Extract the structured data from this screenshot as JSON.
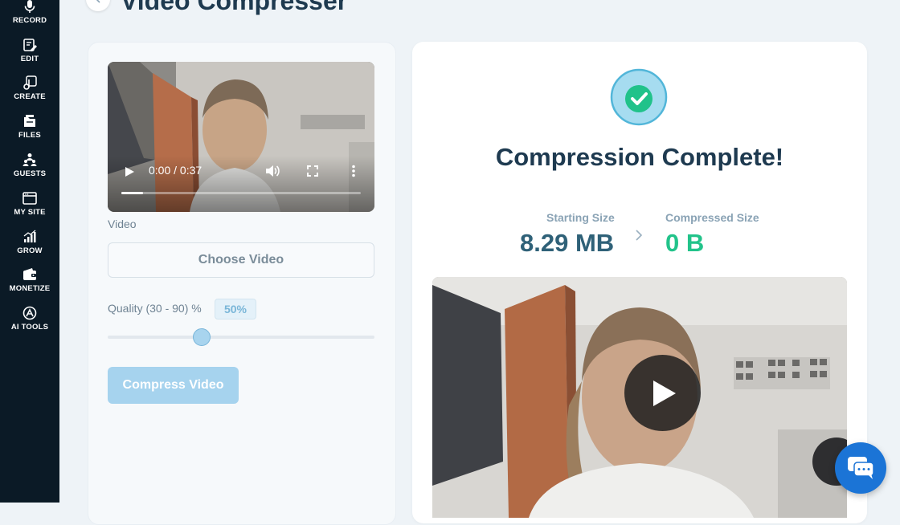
{
  "sidebar": {
    "items": [
      {
        "label": "RECORD",
        "icon": "microphone-icon"
      },
      {
        "label": "EDIT",
        "icon": "edit-icon"
      },
      {
        "label": "CREATE",
        "icon": "music-note-icon"
      },
      {
        "label": "FILES",
        "icon": "files-icon"
      },
      {
        "label": "GUESTS",
        "icon": "guests-icon"
      },
      {
        "label": "MY SITE",
        "icon": "browser-icon"
      },
      {
        "label": "GROW",
        "icon": "bar-chart-icon"
      },
      {
        "label": "MONETIZE",
        "icon": "wallet-icon"
      },
      {
        "label": "AI TOOLS",
        "icon": "ai-icon"
      }
    ]
  },
  "header": {
    "title": "Video Compresser",
    "back_icon": "chevron-left-icon"
  },
  "input_panel": {
    "player": {
      "time": "0:00 / 0:37",
      "progress": 0.09
    },
    "video_label": "Video",
    "choose_button": "Choose Video",
    "quality_label": "Quality (30 - 90) %",
    "quality_value": "50%",
    "quality_slider": 0.35,
    "compress_button": "Compress Video"
  },
  "result_panel": {
    "status_icon": "check-circle-icon",
    "title": "Compression Complete!",
    "starting_label": "Starting Size",
    "starting_value": "8.29 MB",
    "compressed_label": "Compressed Size",
    "compressed_value": "0 B",
    "arrow_icon": "chevron-right-icon",
    "video_play_icon": "play-icon"
  },
  "chat": {
    "icon": "chat-icon"
  },
  "colors": {
    "sidebar_bg": "#0b1a26",
    "accent": "#a6d3ee",
    "success": "#22c38a",
    "title_text": "#1e3a50",
    "stat_value": "#2f6178",
    "chat_blue": "#1b74d6"
  }
}
